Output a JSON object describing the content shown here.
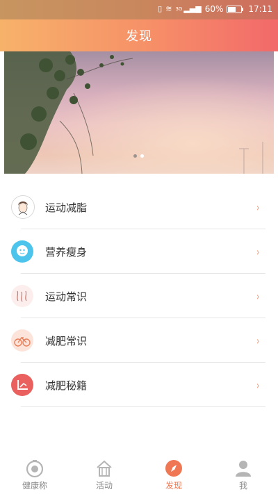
{
  "status_bar": {
    "battery": "60%",
    "time": "17:11",
    "network": "3G"
  },
  "header": {
    "title": "发现"
  },
  "banner": {
    "pages": 2,
    "active_index": 1
  },
  "menu": {
    "items": [
      {
        "label": "运动减脂",
        "icon": "face-avatar-icon"
      },
      {
        "label": "营养瘦身",
        "icon": "face-bubble-icon"
      },
      {
        "label": "运动常识",
        "icon": "squiggle-lines-icon"
      },
      {
        "label": "减肥常识",
        "icon": "bicycle-icon"
      },
      {
        "label": "减肥秘籍",
        "icon": "corner-chart-icon"
      }
    ],
    "chevron": "›"
  },
  "tabs": [
    {
      "label": "健康称",
      "icon": "scale-icon",
      "active": false
    },
    {
      "label": "活动",
      "icon": "activity-house-icon",
      "active": false
    },
    {
      "label": "发现",
      "icon": "compass-icon",
      "active": true
    },
    {
      "label": "我",
      "icon": "person-icon",
      "active": false
    }
  ],
  "colors": {
    "accent": "#ef7753",
    "header_start": "#f7b26a",
    "header_end": "#f2696a"
  }
}
